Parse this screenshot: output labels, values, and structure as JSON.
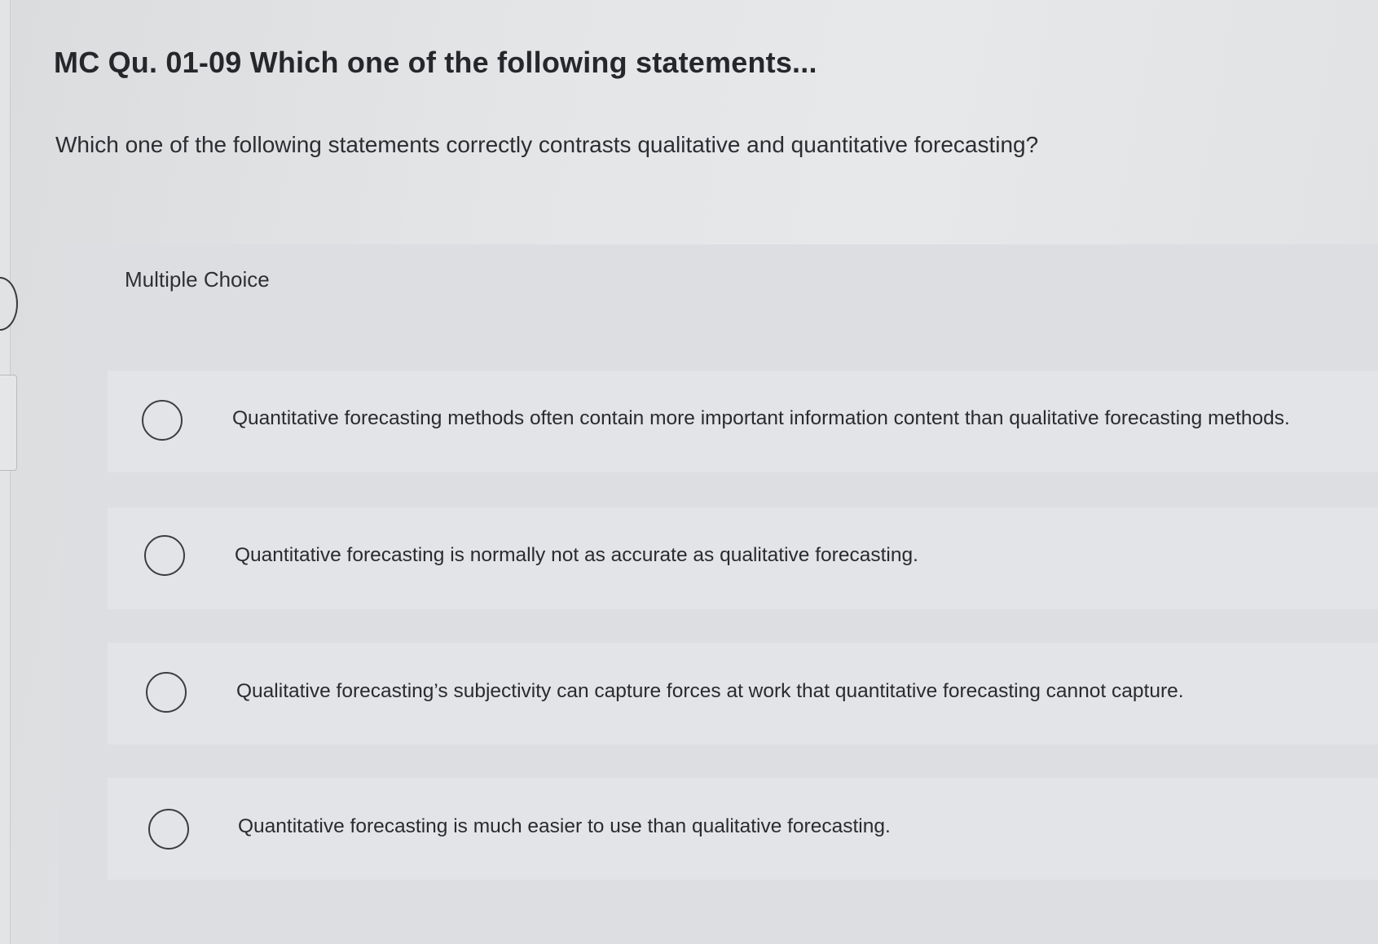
{
  "question": {
    "title": "MC Qu. 01-09 Which one of the following statements...",
    "text": "Which one of the following statements correctly contrasts qualitative and quantitative forecasting?"
  },
  "choices": {
    "label": "Multiple Choice",
    "options": [
      {
        "text": "Quantitative forecasting methods often contain more important information content than qualitative forecasting methods.",
        "selected": false
      },
      {
        "text": "Quantitative forecasting is normally not as accurate as qualitative forecasting.",
        "selected": false
      },
      {
        "text": "Qualitative forecasting’s subjectivity can capture forces at work that quantitative forecasting cannot capture.",
        "selected": false
      },
      {
        "text": "Quantitative forecasting is much easier to use than qualitative forecasting.",
        "selected": false
      }
    ]
  }
}
